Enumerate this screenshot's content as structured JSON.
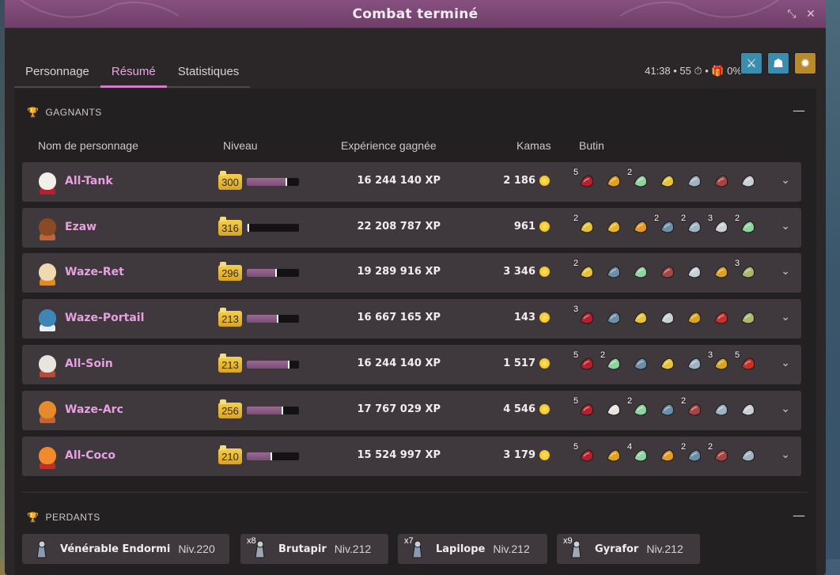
{
  "window": {
    "title": "Combat terminé"
  },
  "tabs": [
    {
      "label": "Personnage",
      "active": false
    },
    {
      "label": "Résumé",
      "active": true
    },
    {
      "label": "Statistiques",
      "active": false
    }
  ],
  "stats": {
    "text": "41:38 • 55 ⏱ • 🎁 0%"
  },
  "winners": {
    "header": "GAGNANTS",
    "columns": {
      "name": "Nom de personnage",
      "level": "Niveau",
      "xp": "Expérience gagnée",
      "kamas": "Kamas",
      "loot": "Butin"
    },
    "rows": [
      {
        "name": "All-Tank",
        "level": "300",
        "level_progress": 0.78,
        "xp": "16 244 140 XP",
        "kamas": "2 186",
        "loot": [
          {
            "q": "5",
            "c": "#b5202c"
          },
          {
            "q": "",
            "c": "#e2a11d"
          },
          {
            "q": "2",
            "c": "#8fd3a0"
          },
          {
            "q": "",
            "c": "#e6c33a"
          },
          {
            "q": "",
            "c": "#9fb4c0"
          },
          {
            "q": "",
            "c": "#a64545"
          },
          {
            "q": "",
            "c": "#c8d0d6"
          }
        ]
      },
      {
        "name": "Ezaw",
        "level": "316",
        "level_progress": 0.04,
        "xp": "22 208 787 XP",
        "kamas": "961",
        "loot": [
          {
            "q": "2",
            "c": "#e2c23a"
          },
          {
            "q": "",
            "c": "#e8b52a"
          },
          {
            "q": "",
            "c": "#e39a2a"
          },
          {
            "q": "2",
            "c": "#6c8fa8"
          },
          {
            "q": "2",
            "c": "#9fb4c0"
          },
          {
            "q": "3",
            "c": "#c8d0d6"
          },
          {
            "q": "2",
            "c": "#8fd3a0"
          }
        ]
      },
      {
        "name": "Waze-Ret",
        "level": "296",
        "level_progress": 0.58,
        "xp": "19 289 916 XP",
        "kamas": "3 346",
        "loot": [
          {
            "q": "2",
            "c": "#e6c33a"
          },
          {
            "q": "",
            "c": "#6c8fa8"
          },
          {
            "q": "",
            "c": "#8fd3a0"
          },
          {
            "q": "",
            "c": "#a64545"
          },
          {
            "q": "",
            "c": "#c8d0d6"
          },
          {
            "q": "",
            "c": "#d9a520"
          },
          {
            "q": "3",
            "c": "#a9b86a"
          }
        ]
      },
      {
        "name": "Waze-Portail",
        "level": "213",
        "level_progress": 0.6,
        "xp": "16 667 165 XP",
        "kamas": "143",
        "loot": [
          {
            "q": "3",
            "c": "#b5202c"
          },
          {
            "q": "",
            "c": "#6c8fa8"
          },
          {
            "q": "",
            "c": "#e6c33a"
          },
          {
            "q": "",
            "c": "#c8d0d6"
          },
          {
            "q": "",
            "c": "#d9a520"
          },
          {
            "q": "",
            "c": "#c8302a"
          },
          {
            "q": "",
            "c": "#a9b86a"
          }
        ]
      },
      {
        "name": "All-Soin",
        "level": "213",
        "level_progress": 0.82,
        "xp": "16 244 140 XP",
        "kamas": "1 517",
        "loot": [
          {
            "q": "5",
            "c": "#b5202c"
          },
          {
            "q": "2",
            "c": "#8fd3a0"
          },
          {
            "q": "",
            "c": "#6c8fa8"
          },
          {
            "q": "",
            "c": "#e6c33a"
          },
          {
            "q": "",
            "c": "#9fb4c0"
          },
          {
            "q": "3",
            "c": "#d9a520"
          },
          {
            "q": "5",
            "c": "#c8302a"
          }
        ]
      },
      {
        "name": "Waze-Arc",
        "level": "256",
        "level_progress": 0.7,
        "xp": "17 767 029 XP",
        "kamas": "4 546",
        "loot": [
          {
            "q": "5",
            "c": "#b5202c"
          },
          {
            "q": "",
            "c": "#e8e4e0"
          },
          {
            "q": "2",
            "c": "#8fd3a0"
          },
          {
            "q": "",
            "c": "#6c8fa8"
          },
          {
            "q": "2",
            "c": "#a64545"
          },
          {
            "q": "",
            "c": "#9fb4c0"
          },
          {
            "q": "",
            "c": "#c8d0d6"
          }
        ]
      },
      {
        "name": "All-Coco",
        "level": "210",
        "level_progress": 0.48,
        "xp": "15 524 997 XP",
        "kamas": "3 179",
        "loot": [
          {
            "q": "5",
            "c": "#b5202c"
          },
          {
            "q": "",
            "c": "#e2a11d"
          },
          {
            "q": "4",
            "c": "#8fd3a0"
          },
          {
            "q": "",
            "c": "#e39a2a"
          },
          {
            "q": "2",
            "c": "#6c8fa8"
          },
          {
            "q": "2",
            "c": "#a64545"
          },
          {
            "q": "",
            "c": "#9fb4c0"
          }
        ]
      }
    ]
  },
  "losers": {
    "header": "PERDANTS",
    "items": [
      {
        "qty": "",
        "name": "Vénérable Endormi",
        "level": "Niv.220"
      },
      {
        "qty": "x8",
        "name": "Brutapir",
        "level": "Niv.212"
      },
      {
        "qty": "x7",
        "name": "Lapilope",
        "level": "Niv.212"
      },
      {
        "qty": "x9",
        "name": "Gyrafor",
        "level": "Niv.212"
      }
    ]
  },
  "colors": {
    "accent": "#d27bc9",
    "name": "#e7a0e0",
    "title_bar": "#7a4873"
  }
}
